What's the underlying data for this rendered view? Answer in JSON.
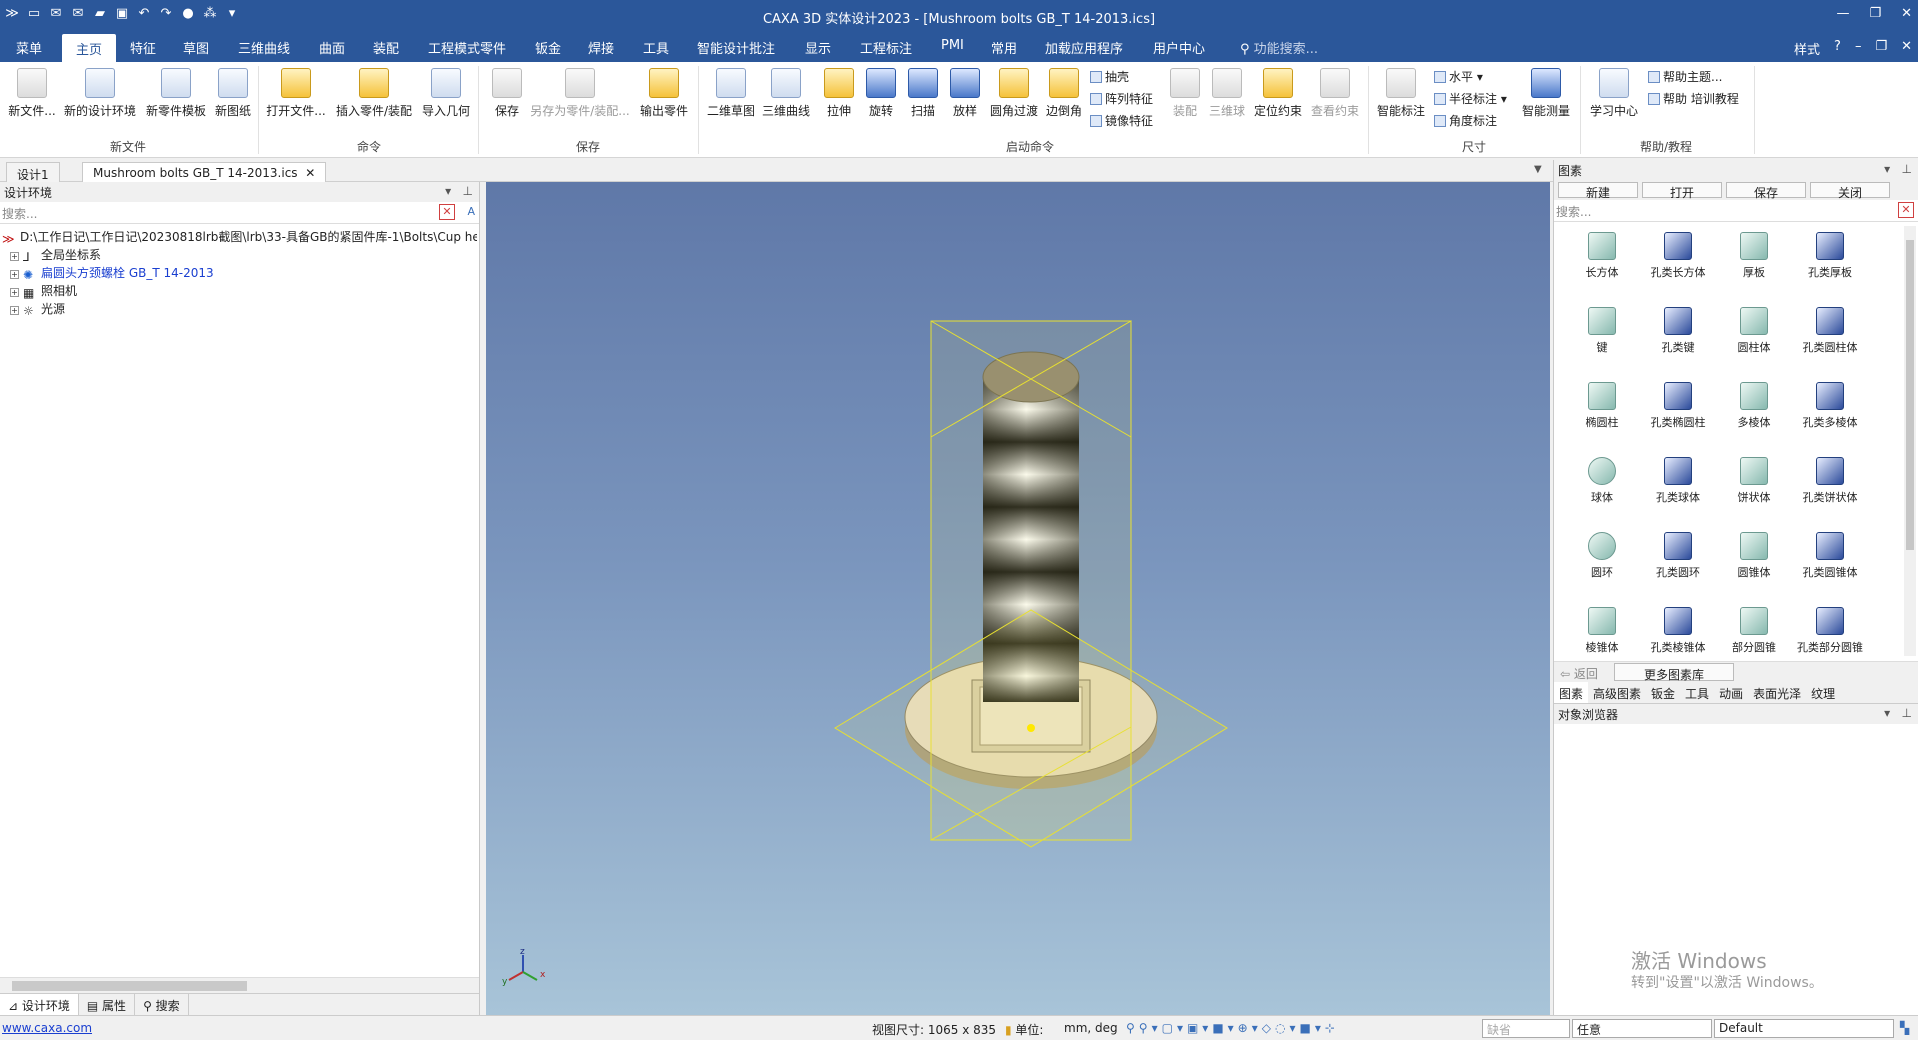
{
  "app": {
    "title": "CAXA 3D 实体设计2023 - [Mushroom bolts GB_T 14-2013.ics]"
  },
  "menu": {
    "tabs": [
      "菜单",
      "主页",
      "特征",
      "草图",
      "三维曲线",
      "曲面",
      "装配",
      "工程模式零件",
      "钣金",
      "焊接",
      "工具",
      "智能设计批注",
      "显示",
      "工程标注",
      "PMI",
      "常用",
      "加载应用程序",
      "用户中心"
    ],
    "search_placeholder": "功能搜索...",
    "style_label": "样式"
  },
  "ribbon": {
    "groups": {
      "new_file": "新文件",
      "command": "命令",
      "save": "保存",
      "launch": "启动命令",
      "dimension": "尺寸",
      "help": "帮助/教程"
    },
    "buttons": {
      "new_file": "新文件...",
      "new_env": "新的设计环境",
      "new_template": "新零件模板",
      "new_drawing": "新图纸",
      "open_file": "打开文件...",
      "insert_part": "插入零件/装配",
      "import_geo": "导入几何",
      "save": "保存",
      "save_as": "另存为零件/装配...",
      "export_part": "输出零件",
      "sketch2d": "二维草图",
      "curve3d": "三维曲线",
      "extrude": "拉伸",
      "revolve": "旋转",
      "sweep": "扫描",
      "loft": "放样",
      "fillet": "圆角过渡",
      "chamfer": "边倒角",
      "shell": "抽壳",
      "pattern": "阵列特征",
      "mirror": "镜像特征",
      "assemble": "装配",
      "ball3d": "三维球",
      "position_constraint": "定位约束",
      "view_constraint": "查看约束",
      "smart_dim": "智能标注",
      "horizontal": "水平",
      "radius_dim": "半径标注",
      "angle_dim": "角度标注",
      "smart_measure": "智能测量",
      "learning": "学习中心",
      "help_topics": "帮助主题...",
      "help_training": "帮助 培训教程"
    }
  },
  "doc_tabs": [
    "设计1",
    "Mushroom bolts GB_T 14-2013.ics"
  ],
  "left_panel": {
    "title": "设计环境",
    "search_placeholder": "搜索...",
    "tree": [
      {
        "label": "D:\\工作日记\\工作日记\\20230818lrb截图\\lrb\\33-具备GB的紧固件库-1\\Bolts\\Cup he"
      },
      {
        "label": "全局坐标系"
      },
      {
        "label": "扁圆头方颈螺栓 GB_T 14-2013"
      },
      {
        "label": "照相机"
      },
      {
        "label": "光源"
      }
    ],
    "bottom_tabs": [
      "设计环境",
      "属性",
      "搜索"
    ]
  },
  "right_panel": {
    "title": "图素",
    "toolbar": [
      "新建",
      "打开",
      "保存",
      "关闭"
    ],
    "search_placeholder": "搜索...",
    "items": [
      "长方体",
      "孔类长方体",
      "厚板",
      "孔类厚板",
      "键",
      "孔类键",
      "圆柱体",
      "孔类圆柱体",
      "椭圆柱",
      "孔类椭圆柱",
      "多棱体",
      "孔类多棱体",
      "球体",
      "孔类球体",
      "饼状体",
      "孔类饼状体",
      "圆环",
      "孔类圆环",
      "圆锥体",
      "孔类圆锥体",
      "棱锥体",
      "孔类棱锥体",
      "部分圆锥",
      "孔类部分圆锥"
    ],
    "back": "返回",
    "more": "更多图素库",
    "tabs": [
      "图素",
      "高级图素",
      "钣金",
      "工具",
      "动画",
      "表面光泽",
      "纹理"
    ],
    "object_browser": "对象浏览器"
  },
  "status": {
    "url": "www.caxa.com",
    "view_size": "视图尺寸: 1065 x  835",
    "unit_label": "单位:",
    "unit_value": "mm, deg",
    "default_box": "缺省",
    "mode": "任意",
    "style": "Default"
  },
  "watermark": {
    "line1": "激活 Windows",
    "line2": "转到\"设置\"以激活 Windows。"
  },
  "triad": {
    "x": "x",
    "y": "y",
    "z": "z"
  }
}
